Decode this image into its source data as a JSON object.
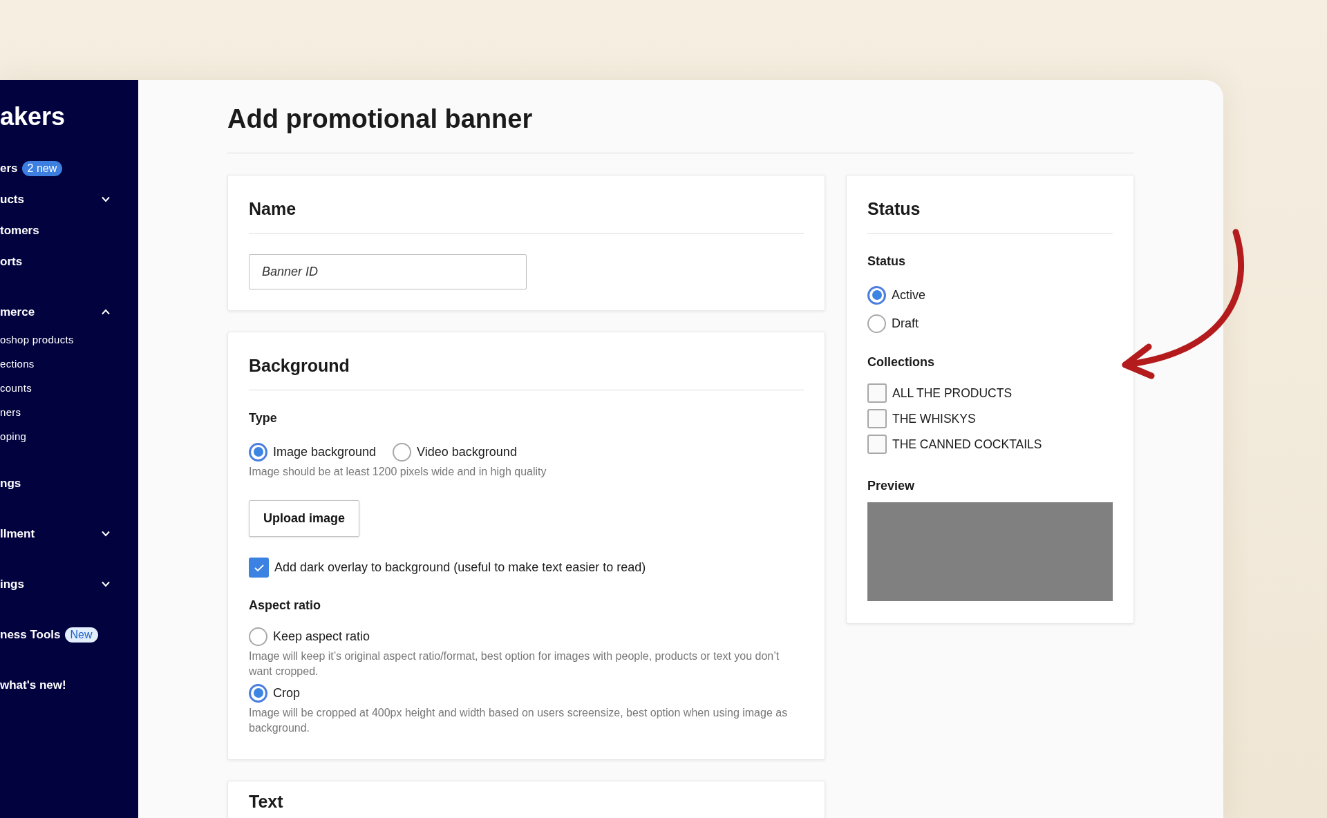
{
  "sidebar": {
    "logo": "akers",
    "sections": [
      {
        "items": [
          {
            "label": "ers",
            "badge": {
              "text": "2 new",
              "kind": "count"
            }
          },
          {
            "label": "ucts",
            "expanded": false
          },
          {
            "label": "tomers"
          },
          {
            "label": "orts"
          }
        ]
      },
      {
        "items": [
          {
            "label": "merce",
            "expanded": true,
            "children": [
              {
                "label": "oshop products"
              },
              {
                "label": "ections"
              },
              {
                "label": "counts"
              },
              {
                "label": "ners"
              },
              {
                "label": "oping"
              }
            ]
          }
        ]
      },
      {
        "items": [
          {
            "label": "ngs"
          }
        ]
      },
      {
        "items": [
          {
            "label": "llment",
            "expanded": false
          }
        ]
      },
      {
        "items": [
          {
            "label": "ings",
            "expanded": false
          }
        ]
      },
      {
        "items": [
          {
            "label": "ness Tools",
            "badge": {
              "text": "New",
              "kind": "new"
            }
          }
        ]
      },
      {
        "items": [
          {
            "label": "what's new!"
          }
        ]
      }
    ]
  },
  "page_title": "Add promotional banner",
  "name_card": {
    "title": "Name",
    "input": {
      "placeholder": "Banner ID"
    }
  },
  "background_card": {
    "title": "Background",
    "sections": [
      {
        "kind": "radio-row",
        "label": "Type",
        "options": [
          {
            "label": "Image background",
            "selected": true
          },
          {
            "label": "Video background",
            "selected": false
          }
        ],
        "help": "Image should be at least 1200 pixels wide and in high quality"
      },
      {
        "kind": "button",
        "label": "Upload image"
      },
      {
        "kind": "checkbox",
        "label": "Add dark overlay to background (useful to make text easier to read)",
        "checked": true
      },
      {
        "kind": "radio-list",
        "label": "Aspect ratio",
        "options": [
          {
            "label": "Keep aspect ratio",
            "selected": false,
            "help": "Image will keep it’s original aspect ratio/format, best option for images with people, products or text you don’t want cropped."
          },
          {
            "label": "Crop",
            "selected": true,
            "help": "Image will be cropped at 400px height and width based on users screensize, best option when using image as background."
          }
        ]
      }
    ]
  },
  "text_card": {
    "title": "Text"
  },
  "status_card": {
    "title": "Status",
    "status": {
      "label": "Status",
      "options": [
        {
          "label": "Active",
          "selected": true
        },
        {
          "label": "Draft",
          "selected": false
        }
      ]
    },
    "collections": {
      "label": "Collections",
      "items": [
        {
          "label": "ALL THE PRODUCTS",
          "checked": false
        },
        {
          "label": "THE WHISKYS",
          "checked": false
        },
        {
          "label": "THE CANNED COCKTAILS",
          "checked": false
        }
      ]
    },
    "preview": {
      "label": "Preview"
    }
  }
}
